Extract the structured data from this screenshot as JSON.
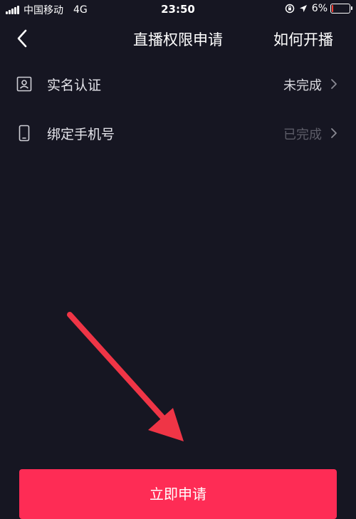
{
  "status_bar": {
    "carrier": "中国移动",
    "network": "4G",
    "time": "23:50",
    "battery": "6%",
    "battery_level": 0.06,
    "battery_color": "#ff3b30",
    "icons": [
      "signal-icon",
      "lock-rotation-icon",
      "location-icon",
      "battery-icon"
    ]
  },
  "nav": {
    "back_icon": "chevron-left-icon",
    "title": "直播权限申请",
    "action": "如何开播"
  },
  "items": [
    {
      "icon": "id-card-icon",
      "label": "实名认证",
      "status": "未完成",
      "status_color": "#d8d8de"
    },
    {
      "icon": "phone-icon",
      "label": "绑定手机号",
      "status": "已完成",
      "status_color": "#5d5d68"
    }
  ],
  "annotation": {
    "type": "arrow",
    "color": "#ef3546"
  },
  "apply_button": {
    "label": "立即申请",
    "color": "#fe2c55"
  }
}
